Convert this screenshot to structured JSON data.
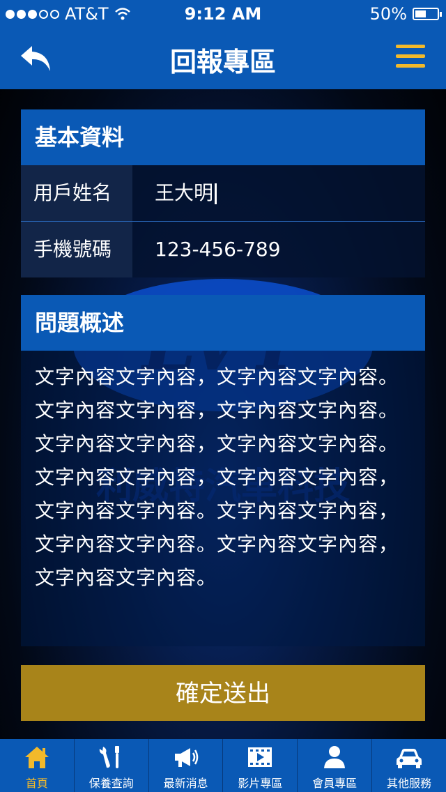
{
  "status_bar": {
    "carrier": "AT&T",
    "time": "9:12 AM",
    "battery": "50%"
  },
  "nav": {
    "title": "回報專區"
  },
  "basic_info": {
    "header": "基本資料",
    "name_label": "用戶姓名",
    "name_value": "王大明",
    "phone_label": "手機號碼",
    "phone_value": "123-456-789"
  },
  "description": {
    "header": "問題概述",
    "text": "文字內容文字內容，文字內容文字內容。文字內容文字內容，文字內容文字內容。文字內容文字內容，文字內容文字內容。文字內容文字內容，文字內容文字內容，文字內容文字內容。文字內容文字內容，文字內容文字內容。文字內容文字內容，文字內容文字內容。"
  },
  "watermark": {
    "logo_text": "LVT",
    "caption": "利威特汽車科技"
  },
  "submit_label": "確定送出",
  "tabs": [
    {
      "label": "首頁",
      "icon": "home-icon"
    },
    {
      "label": "保養查詢",
      "icon": "tools-icon"
    },
    {
      "label": "最新消息",
      "icon": "megaphone-icon"
    },
    {
      "label": "影片專區",
      "icon": "video-icon"
    },
    {
      "label": "會員專區",
      "icon": "person-icon"
    },
    {
      "label": "其他服務",
      "icon": "car-icon"
    }
  ],
  "colors": {
    "primary": "#0a59b5",
    "accent": "#f2b92b",
    "submit": "#a8841a"
  }
}
